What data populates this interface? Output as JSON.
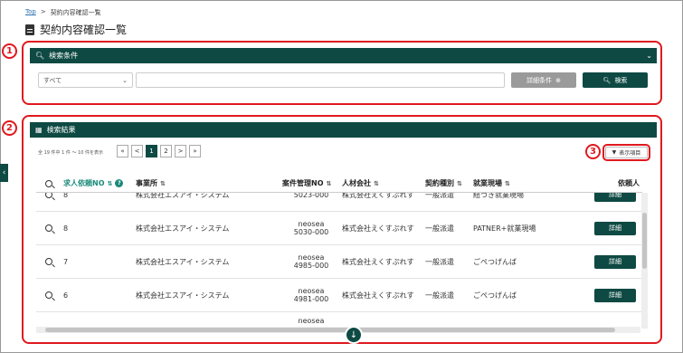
{
  "breadcrumb": {
    "top": "Top",
    "sep": ">",
    "current": "契約内容確認一覧"
  },
  "page_title": "契約内容確認一覧",
  "markers": [
    "1",
    "2",
    "3"
  ],
  "search": {
    "header": "検索条件",
    "select_value": "すべて",
    "detail_button": "詳細条件",
    "search_button": "検索"
  },
  "results": {
    "header": "検索結果",
    "count_text": "全 19 件中 1 件 ～ 10 件を表示",
    "pager": [
      "«",
      "<",
      "1",
      "2",
      ">",
      "»"
    ],
    "columns_button": "表示項目",
    "columns": [
      "求人依頼NO",
      "事業所",
      "案件管理NO",
      "人材会社",
      "契約種別",
      "就業現場",
      "依頼人"
    ],
    "rows": [
      {
        "no": "8",
        "office": "株式会社エスアイ・システム",
        "mgmt1": "",
        "mgmt2": "5023-000",
        "agency": "株式会社えくすぷれす",
        "type": "一般派遣",
        "site": "紐づき就業現場",
        "action": "詳細"
      },
      {
        "no": "8",
        "office": "株式会社エスアイ・システム",
        "mgmt1": "neosea",
        "mgmt2": "5030-000",
        "agency": "株式会社えくすぷれす",
        "type": "一般派遣",
        "site": "PATNER+就業現場",
        "action": "詳細"
      },
      {
        "no": "7",
        "office": "株式会社エスアイ・システム",
        "mgmt1": "neosea",
        "mgmt2": "4985-000",
        "agency": "株式会社えくすぷれす",
        "type": "一般派遣",
        "site": "ごぺつげんば",
        "action": "詳細"
      },
      {
        "no": "6",
        "office": "株式会社エスアイ・システム",
        "mgmt1": "neosea",
        "mgmt2": "4981-000",
        "agency": "株式会社えくすぷれす",
        "type": "一般派遣",
        "site": "ごぺつげんば",
        "action": "詳細"
      },
      {
        "no": "",
        "office": "",
        "mgmt1": "neosea",
        "mgmt2": "",
        "agency": "",
        "type": "",
        "site": "",
        "action": ""
      }
    ]
  },
  "colors": {
    "primary": "#0e4a43",
    "highlight": "#e0191f",
    "accent": "#1a8a7a"
  }
}
